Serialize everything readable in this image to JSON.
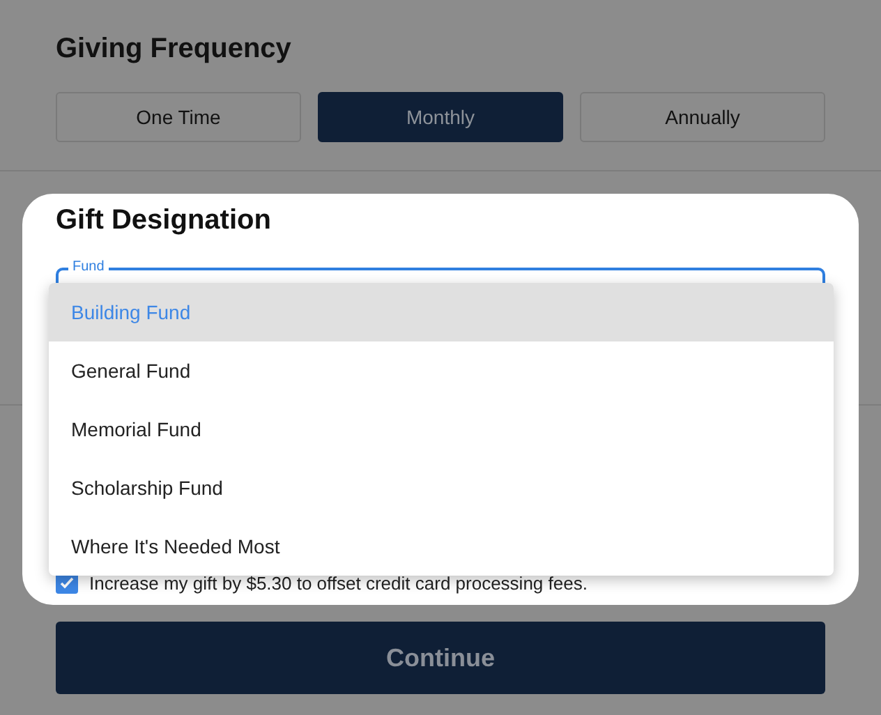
{
  "frequency": {
    "title": "Giving Frequency",
    "options": [
      {
        "label": "One Time",
        "selected": false
      },
      {
        "label": "Monthly",
        "selected": true
      },
      {
        "label": "Annually",
        "selected": false
      }
    ]
  },
  "designation": {
    "title": "Gift Designation",
    "field_label": "Fund",
    "menu": [
      {
        "label": "Building Fund",
        "selected": true
      },
      {
        "label": "General Fund",
        "selected": false
      },
      {
        "label": "Memorial Fund",
        "selected": false
      },
      {
        "label": "Scholarship Fund",
        "selected": false
      },
      {
        "label": "Where It's Needed Most",
        "selected": false
      }
    ],
    "fee_option": {
      "label": "Increase my gift by $5.30 to offset credit card processing fees.",
      "checked": true
    }
  },
  "continue_button": "Continue"
}
